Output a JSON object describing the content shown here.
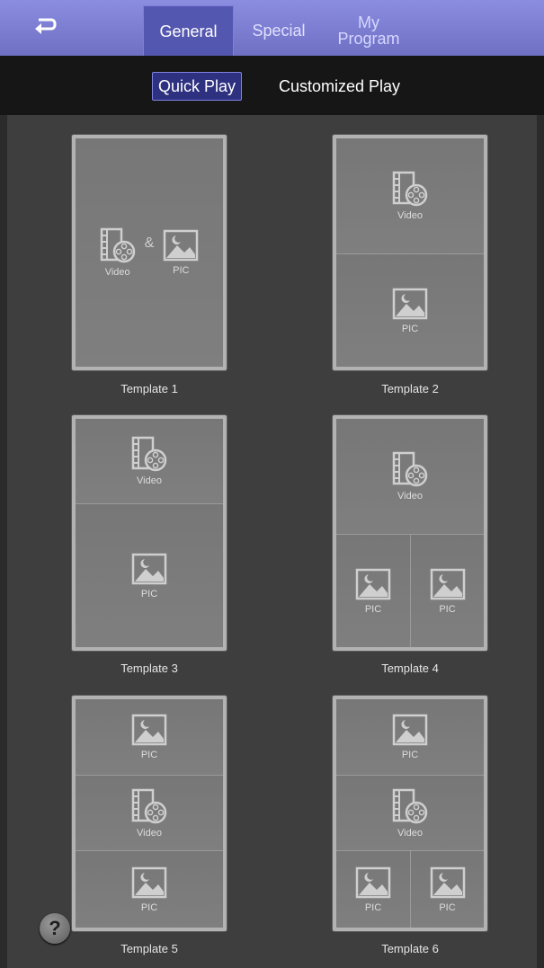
{
  "nav": {
    "back_icon": "back-arrow-icon",
    "tabs": [
      {
        "label": "General"
      },
      {
        "label": "Special"
      },
      {
        "label": "My\nProgram"
      }
    ]
  },
  "modes": {
    "quick": "Quick Play",
    "custom": "Customized Play"
  },
  "templates": [
    {
      "caption": "Template 1",
      "video": "Video",
      "amp": "&",
      "pic": "PIC"
    },
    {
      "caption": "Template 2",
      "video": "Video",
      "pic": "PIC"
    },
    {
      "caption": "Template 3",
      "video": "Video",
      "pic": "PIC"
    },
    {
      "caption": "Template 4",
      "video": "Video",
      "pic_left": "PIC",
      "pic_right": "PIC"
    },
    {
      "caption": "Template 5",
      "pic_top": "PIC",
      "video": "Video",
      "pic_bottom": "PIC"
    },
    {
      "caption": "Template 6",
      "pic_top": "PIC",
      "video": "Video",
      "pic_left": "PIC",
      "pic_right": "PIC"
    }
  ],
  "help": {
    "label": "?"
  },
  "colors": {
    "header": "#7b7dd6",
    "active_tab": "#5457b0",
    "subbar": "#161616",
    "background": "#3e3e3e",
    "template_frame": "#b2b2b2"
  }
}
